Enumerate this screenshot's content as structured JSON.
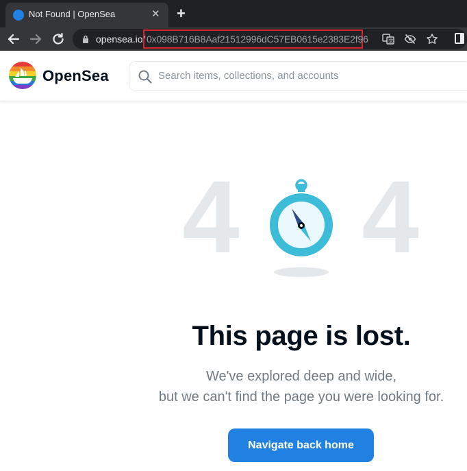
{
  "browser": {
    "tab_title": "Not Found | OpenSea",
    "tab_close": "✕",
    "new_tab": "+",
    "url_host": "opensea.io/",
    "url_path": "0x098B716B8Aaf21512996dC57EB0615e2383E2f96"
  },
  "header": {
    "logo_text": "OpenSea",
    "search_placeholder": "Search items, collections, and accounts"
  },
  "error": {
    "digit_left": "4",
    "digit_right": "4",
    "headline": "This page is lost.",
    "line1": "We've explored deep and wide,",
    "line2": "but we can't find the page you were looking for.",
    "button_label": "Navigate back home"
  },
  "colors": {
    "brand": "#2081e2",
    "highlight_border": "#d6262e",
    "compass_ring": "#3dbcd8"
  }
}
